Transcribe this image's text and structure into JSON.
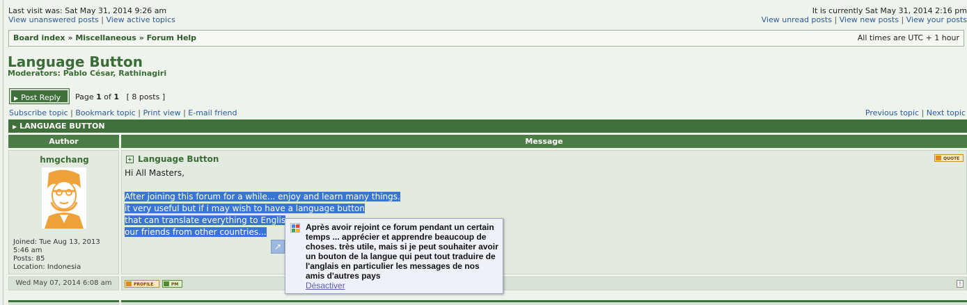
{
  "header": {
    "last_visit": "Last visit was: Sat May 31, 2014 9:26 am",
    "current_time": "It is currently Sat May 31, 2014 2:16 pm",
    "links_left": [
      "View unanswered posts",
      "View active topics"
    ],
    "links_right": [
      "View unread posts",
      "View new posts",
      "View your posts"
    ]
  },
  "breadcrumb": {
    "items": [
      "Board index",
      "Miscellaneous",
      "Forum Help"
    ],
    "separator": "»",
    "timezone": "All times are UTC + 1 hour"
  },
  "topic": {
    "title": "Language Button",
    "moderators_label": "Moderators:",
    "moderators": "Pablo César, Rathinagiri"
  },
  "toolbar": {
    "post_reply": "Post Reply",
    "page_label": "Page",
    "page_current": "1",
    "page_of": "of",
    "page_total": "1",
    "posts_count": "[ 8 posts ]",
    "actions": [
      "Subscribe topic",
      "Bookmark topic",
      "Print view",
      "E-mail friend"
    ],
    "topic_nav": [
      "Previous topic",
      "Next topic"
    ]
  },
  "table": {
    "category": "LANGUAGE BUTTON",
    "col_author": "Author",
    "col_message": "Message"
  },
  "post": {
    "author": "hmgchang",
    "joined": "Joined: Tue Aug 13, 2013",
    "joined_time": "5:46 am",
    "posts": "Posts: 85",
    "location": "Location: Indonesia",
    "subject": "Language Button",
    "quote_label": "QUOTE",
    "greeting": "Hi All Masters,",
    "lines": [
      "After joining this forum for a while... enjoy and learn many things.",
      "it very useful but if i may wish to have a language button",
      "that can translate everything to Englis",
      "our friends from other countries..."
    ],
    "date": "Wed May 07, 2014 6:08 am",
    "profile_label": "PROFILE",
    "pm_label": "PM",
    "report_label": "!"
  },
  "translate_popup": {
    "text": "Après avoir rejoint ce forum pendant un certain temps ... apprécier et apprendre beaucoup de choses. très utile, mais si je peut souhaiter avoir un bouton de la langue qui peut tout traduire de l'anglais en particulier les messages de nos amis d'autres pays",
    "disable_link": "Désactiver"
  },
  "colors": {
    "header_green": "#3f6f3a",
    "title_green": "#3b6b36",
    "link_blue": "#2e5a9a",
    "selection": "#3875d7",
    "popup_bg": "#eef2f8"
  }
}
